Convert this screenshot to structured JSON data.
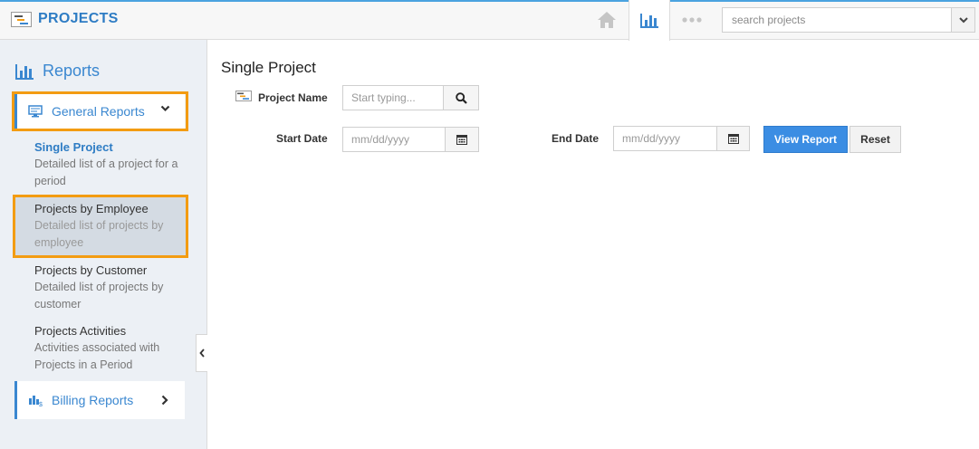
{
  "header": {
    "app_title": "PROJECTS",
    "icons": [
      "home-icon",
      "bar-chart-icon",
      "more-dots-icon"
    ],
    "search": {
      "placeholder": "search projects"
    }
  },
  "sidebar": {
    "heading": "Reports",
    "groups": [
      {
        "label": "General Reports",
        "icon": "monitor-icon",
        "expanded": true
      },
      {
        "label": "Billing Reports",
        "icon": "billing-chart-icon",
        "expanded": false
      }
    ],
    "items": [
      {
        "title": "Single Project",
        "desc": "Detailed list of a project for a period",
        "active": true
      },
      {
        "title": "Projects by Employee",
        "desc": "Detailed list of projects by employee",
        "active": false
      },
      {
        "title": "Projects by Customer",
        "desc": "Detailed list of projects by customer",
        "active": false
      },
      {
        "title": "Projects Activities",
        "desc": "Activities associated with Projects in a Period",
        "active": false
      }
    ]
  },
  "main": {
    "title": "Single Project",
    "project_name": {
      "label": "Project Name",
      "placeholder": "Start typing..."
    },
    "start_date": {
      "label": "Start Date",
      "placeholder": "mm/dd/yyyy"
    },
    "end_date": {
      "label": "End Date",
      "placeholder": "mm/dd/yyyy"
    },
    "view_report_label": "View Report",
    "reset_label": "Reset"
  },
  "colors": {
    "accent": "#3a87d0",
    "highlight": "#f39c12",
    "primary_button": "#3b8de3"
  }
}
